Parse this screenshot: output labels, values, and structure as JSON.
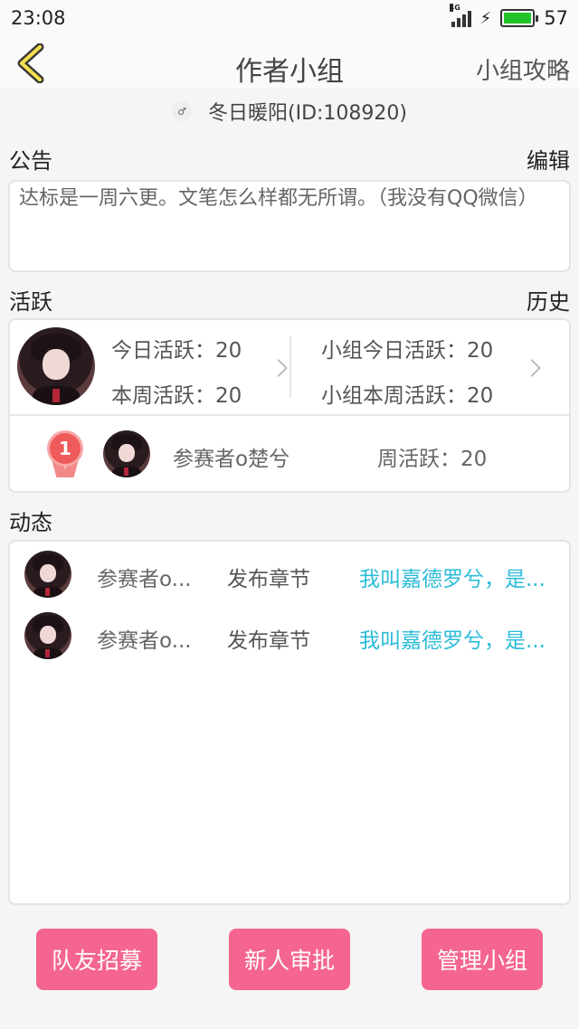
{
  "status_bar": {
    "time": "23:08",
    "network": "4G",
    "battery": "57",
    "battery_color": "#22c22a"
  },
  "nav": {
    "back_icon": "chevron-left-icon",
    "title": "作者小组",
    "guide": "小组攻略"
  },
  "author": {
    "name": "冬日暖阳(ID:108920)"
  },
  "notice": {
    "heading": "公告",
    "edit": "编辑",
    "text": "达标是一周六更。文笔怎么样都无所谓。（我没有QQ微信）"
  },
  "activity": {
    "heading": "活跃",
    "history": "历史",
    "today": "今日活跃：20",
    "week": "本周活跃：20",
    "group_today": "小组今日活跃：20",
    "group_week": "小组本周活跃：20",
    "rank": "1",
    "rank_member": "参赛者o楚兮",
    "rank_weekly": "周活跃：20"
  },
  "dynamics": {
    "heading": "动态",
    "items": [
      {
        "name": "参赛者o...",
        "action": "发布章节",
        "title": "我叫嘉德罗兮，是..."
      },
      {
        "name": "参赛者o...",
        "action": "发布章节",
        "title": "我叫嘉德罗兮，是..."
      }
    ],
    "title_color": "#2bbcd8"
  },
  "buttons": {
    "recruit": "队友招募",
    "approve": "新人审批",
    "manage": "管理小组",
    "color": "#f4668f"
  }
}
